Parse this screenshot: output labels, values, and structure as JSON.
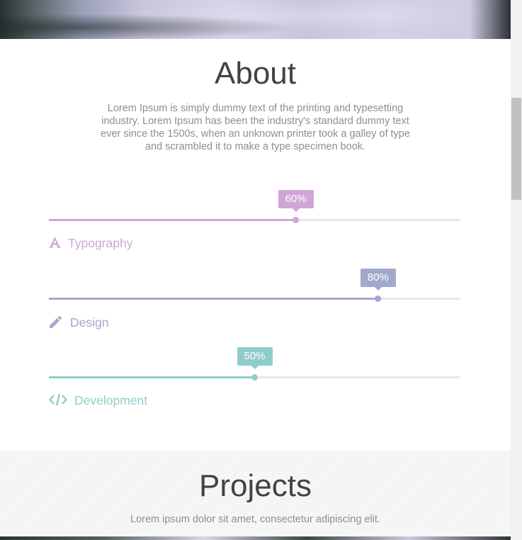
{
  "about": {
    "title": "About",
    "description": "Lorem Ipsum is simply dummy text of the printing and typesetting industry. Lorem Ipsum has been the industry's standard dummy text ever since the 1500s, when an unknown printer took a galley of type and scrambled it to make a type specimen book."
  },
  "skills": [
    {
      "label": "Typography",
      "percent_label": "60%",
      "value": 0.6,
      "icon": "typography-a-icon",
      "color": "#cfa6d6"
    },
    {
      "label": "Design",
      "percent_label": "80%",
      "value": 0.8,
      "icon": "pencil-icon",
      "color": "#a3a9cc"
    },
    {
      "label": "Development",
      "percent_label": "50%",
      "value": 0.5,
      "icon": "code-icon",
      "color": "#8fcdcb"
    }
  ],
  "projects": {
    "title": "Projects",
    "subtitle": "Lorem ipsum dolor sit amet, consectetur adipiscing elit."
  }
}
